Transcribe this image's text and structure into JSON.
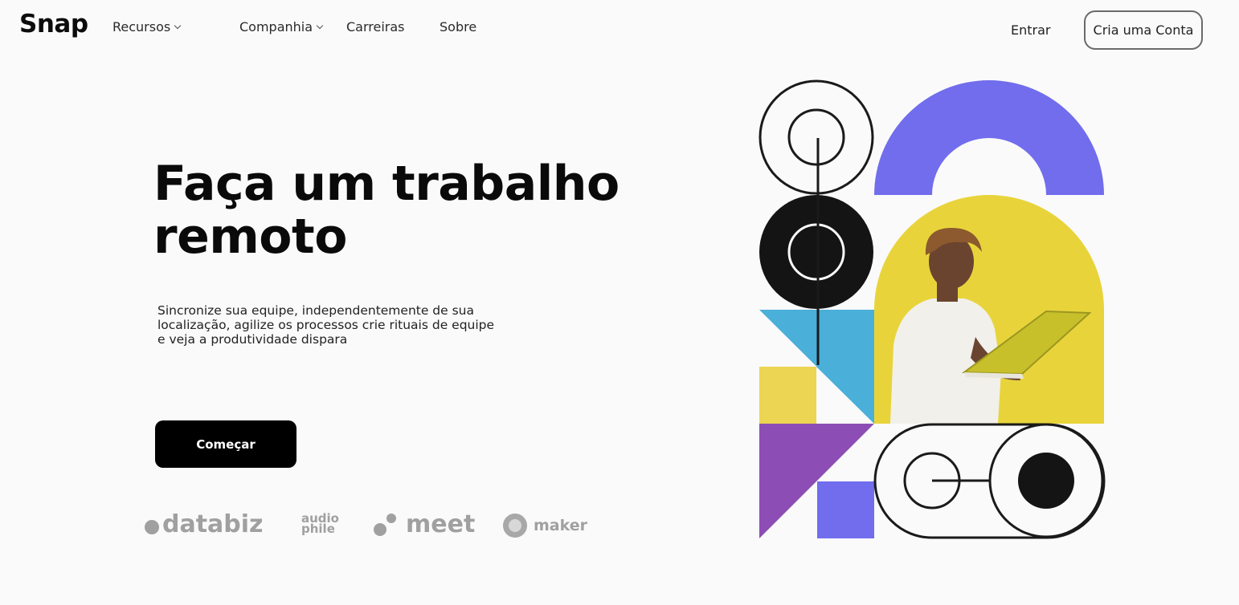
{
  "brand": {
    "logo": "Snap"
  },
  "nav": {
    "items": [
      {
        "label": "Recursos",
        "has_dropdown": true
      },
      {
        "label": "Companhia",
        "has_dropdown": true
      },
      {
        "label": "Carreiras",
        "has_dropdown": false
      },
      {
        "label": "Sobre",
        "has_dropdown": false
      }
    ],
    "login_label": "Entrar",
    "signup_label": "Cria uma Conta"
  },
  "hero": {
    "title_line1": "Faça um trabalho",
    "title_line2": "remoto",
    "description": "Sincronize sua equipe, independentemente de sua localização, agilize os processos crie rituais de equipe e veja a produtividade dispara",
    "cta_label": "Começar"
  },
  "clients": [
    {
      "name": "databiz"
    },
    {
      "name_line1": "audio",
      "name_line2": "phile"
    },
    {
      "name": "meet"
    },
    {
      "name": "maker"
    }
  ],
  "colors": {
    "background": "#fafafa",
    "cta": "#000000",
    "purple_arch": "#716ded",
    "yellow": "#e8d43a",
    "cyan": "#4aafd9",
    "violet": "#8c4eb5",
    "periwinkle": "#716ded",
    "client_gray": "#a0a0a0"
  }
}
